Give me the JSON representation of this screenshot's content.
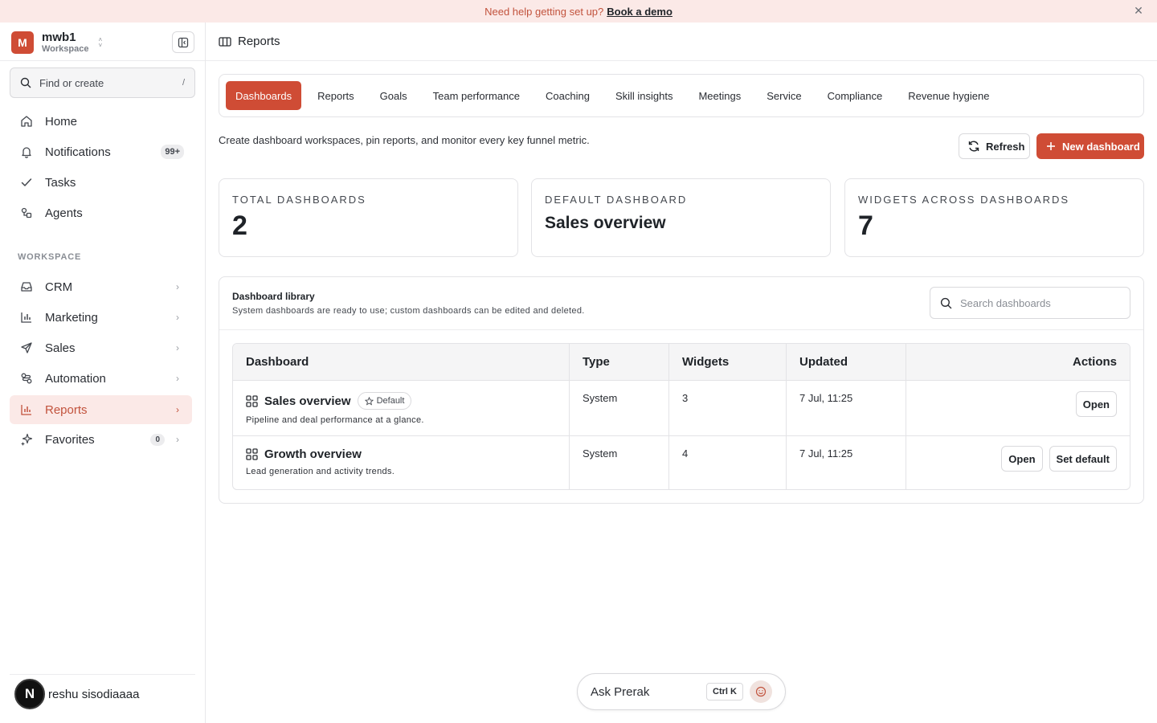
{
  "banner": {
    "text": "Need help getting set up?",
    "link": "Book a demo"
  },
  "workspace": {
    "initial": "M",
    "name": "mwb1",
    "subtitle": "Workspace"
  },
  "search": {
    "label": "Find or create",
    "shortcut": "/"
  },
  "nav": {
    "home": "Home",
    "notifications": "Notifications",
    "notifications_badge": "99+",
    "tasks": "Tasks",
    "agents": "Agents",
    "section": "WORKSPACE",
    "crm": "CRM",
    "marketing": "Marketing",
    "sales": "Sales",
    "automation": "Automation",
    "reports": "Reports",
    "favorites": "Favorites",
    "favorites_badge": "0"
  },
  "user": {
    "initial": "N",
    "name": "reshu sisodiaaaa"
  },
  "topbar": {
    "title": "Reports"
  },
  "tabs": [
    "Dashboards",
    "Reports",
    "Goals",
    "Team performance",
    "Coaching",
    "Skill insights",
    "Meetings",
    "Service",
    "Compliance",
    "Revenue hygiene"
  ],
  "page": {
    "description": "Create dashboard workspaces, pin reports, and monitor every key funnel metric.",
    "refresh": "Refresh",
    "new_dashboard": "New dashboard"
  },
  "stats": {
    "total_label": "TOTAL DASHBOARDS",
    "total_value": "2",
    "default_label": "DEFAULT DASHBOARD",
    "default_value": "Sales overview",
    "widgets_label": "WIDGETS ACROSS DASHBOARDS",
    "widgets_value": "7"
  },
  "library": {
    "title": "Dashboard library",
    "subtitle": "System dashboards are ready to use; custom dashboards can be edited and deleted.",
    "search_placeholder": "Search dashboards",
    "columns": [
      "Dashboard",
      "Type",
      "Widgets",
      "Updated",
      "Actions"
    ],
    "rows": [
      {
        "name": "Sales overview",
        "badge": "Default",
        "description": "Pipeline and deal performance at a glance.",
        "type": "System",
        "widgets": "3",
        "updated": "7 Jul, 11:25",
        "open": "Open"
      },
      {
        "name": "Growth overview",
        "description": "Lead generation and activity trends.",
        "type": "System",
        "widgets": "4",
        "updated": "7 Jul, 11:25",
        "open": "Open",
        "set_default": "Set default"
      }
    ]
  },
  "ask": {
    "label": "Ask Prerak",
    "shortcut": "Ctrl K"
  },
  "colors": {
    "accent": "#cf4c35",
    "accent_soft": "#fbe9e7"
  }
}
